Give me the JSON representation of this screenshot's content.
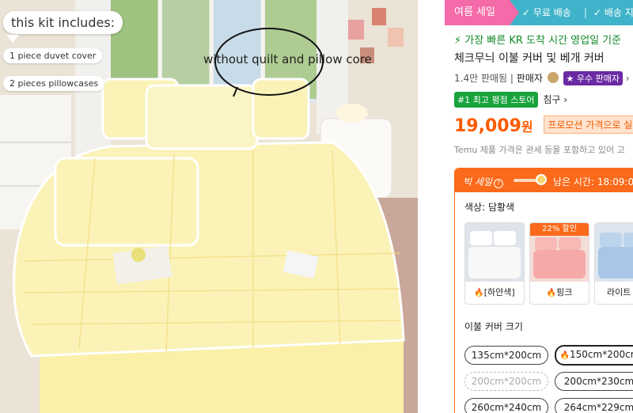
{
  "photo": {
    "kit_title": "this kit includes:",
    "item1": "1 piece duvet cover",
    "item2": "2 pieces pillowcases",
    "note": "without quilt and pillow core"
  },
  "banner": {
    "sale": "여름 세일",
    "b1": "✓ 무료 배송",
    "sep": "|",
    "b2": "✓ 배송 지"
  },
  "product": {
    "fast": "⚡ 가장 빠른 KR 도착 시간 영업일 기준",
    "title": "체크무늬 이불 커버 및 베개 커버",
    "sold": "1.4만 판매됨",
    "sep": "|",
    "seller_label": "판매자",
    "seller_badge": "★ 우수 판매자",
    "chevron": "›",
    "rank_badge": "#1 최고 평점 스토어",
    "rank_category": "침구 ›",
    "price": "19,009",
    "price_unit": "원",
    "promo": "프로모션 가격으로 실",
    "fine": "Temu 제품 가격은 관세 등을 포함하고 있어 고"
  },
  "deal": {
    "label": "빅 세일",
    "help": "?",
    "timer": "남은 시간: 18:09:0"
  },
  "colors": {
    "label": "색상: 담황색",
    "options": [
      {
        "name": "[하얀색]",
        "discount": ""
      },
      {
        "name": "핑크",
        "discount": "22% 할인"
      },
      {
        "name": "라이트 블",
        "discount": ""
      }
    ]
  },
  "sizes": {
    "label": "이불 커버 크기",
    "options": [
      {
        "label": "135cm*200cm",
        "state": "normal"
      },
      {
        "label": "150cm*200cm",
        "state": "selected"
      },
      {
        "label": "200cm*200cm",
        "state": "disabled"
      },
      {
        "label": "200cm*230cm",
        "state": "normal"
      },
      {
        "label": "260cm*240cm",
        "state": "normal"
      },
      {
        "label": "264cm*229cm",
        "state": "normal"
      }
    ]
  },
  "theme": {
    "accent": "#fb6a1a",
    "price": "#fb5b00",
    "banner": "#3fb3c9",
    "sale": "#f56aa8"
  }
}
